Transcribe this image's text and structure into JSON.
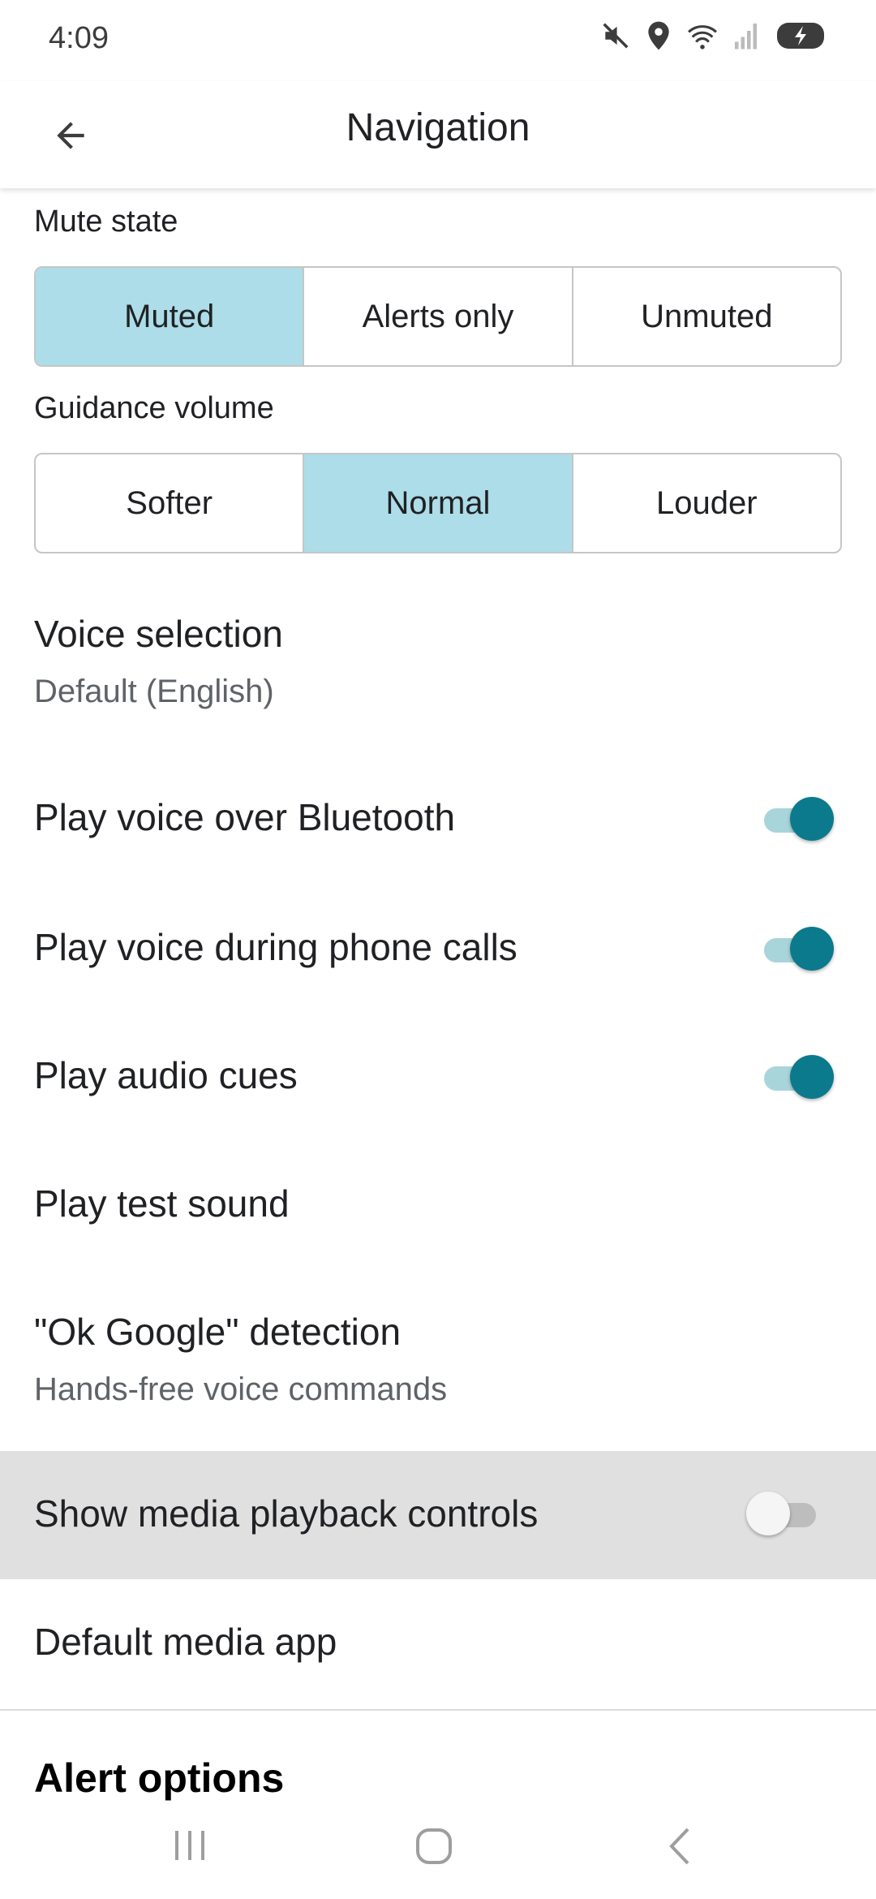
{
  "status": {
    "time": "4:09"
  },
  "appbar": {
    "title": "Navigation"
  },
  "mute_state": {
    "label": "Mute state",
    "options": [
      "Muted",
      "Alerts only",
      "Unmuted"
    ],
    "selected": "Muted"
  },
  "guidance_volume": {
    "label": "Guidance volume",
    "options": [
      "Softer",
      "Normal",
      "Louder"
    ],
    "selected": "Normal"
  },
  "voice_selection": {
    "title": "Voice selection",
    "subtitle": "Default (English)"
  },
  "bluetooth": {
    "title": "Play voice over Bluetooth",
    "enabled": true
  },
  "phone_calls": {
    "title": "Play voice during phone calls",
    "enabled": true
  },
  "audio_cues": {
    "title": "Play audio cues",
    "enabled": true
  },
  "test_sound": {
    "title": "Play test sound"
  },
  "ok_google": {
    "title": "\"Ok Google\" detection",
    "subtitle": "Hands-free voice commands"
  },
  "media_controls": {
    "title": "Show media playback controls",
    "enabled": false
  },
  "media_app": {
    "title": "Default media app"
  },
  "alert_options": {
    "title": "Alert options"
  },
  "colors": {
    "accent": "#0b7a8c",
    "selected_segment": "#acdde8",
    "highlight_row": "#e0e0e0"
  }
}
